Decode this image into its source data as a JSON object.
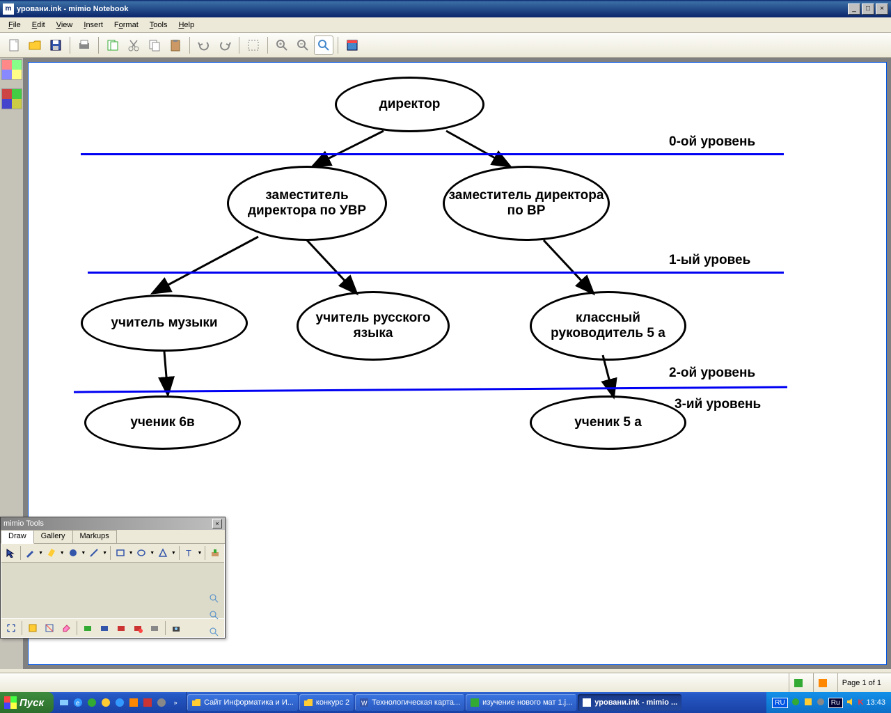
{
  "window": {
    "title": "уровани.ink - mimio Notebook",
    "minimize": "_",
    "maximize": "□",
    "close": "×"
  },
  "menu": {
    "file": "File",
    "edit": "Edit",
    "view": "View",
    "insert": "Insert",
    "format": "Format",
    "tools": "Tools",
    "help": "Help"
  },
  "toolbar": {
    "new": "New",
    "open": "Open",
    "save": "Save",
    "print": "Print",
    "cut": "Cut",
    "copy": "Copy",
    "paste": "Paste",
    "undo": "Undo",
    "redo": "Redo",
    "zoom_in": "Zoom In",
    "zoom_out": "Zoom Out",
    "zoom_fit": "Zoom Fit",
    "fullscreen": "Fullscreen",
    "insert_page": "Insert Page"
  },
  "diagram": {
    "nodes": {
      "director": "директор",
      "deputy_uvr": "заместитель директора по УВР",
      "deputy_vr": "заместитель директора по ВР",
      "music_teacher": "учитель музыки",
      "russian_teacher": "учитель русского языка",
      "class_leader": "классный руководитель 5 а",
      "student_6v": "ученик 6в",
      "student_5a": "ученик 5 а"
    },
    "levels": {
      "l0": "0-ой уровень",
      "l1": "1-ый уровеь",
      "l2": "2-ой уровень",
      "l3": "3-ий уровень"
    }
  },
  "tools_window": {
    "title": "mimio Tools",
    "tabs": {
      "draw": "Draw",
      "gallery": "Gallery",
      "markups": "Markups"
    }
  },
  "statusbar": {
    "page": "Page 1 of 1"
  },
  "taskbar": {
    "start": "Пуск",
    "task1": "Сайт Информатика и И...",
    "task2": "конкурс 2",
    "task3": "Технологическая карта...",
    "task4": "изучение нового мат 1.j...",
    "task5": "уровани.ink - mimio ...",
    "lang1": "RU",
    "lang2": "Ru",
    "clock": "13:43"
  }
}
